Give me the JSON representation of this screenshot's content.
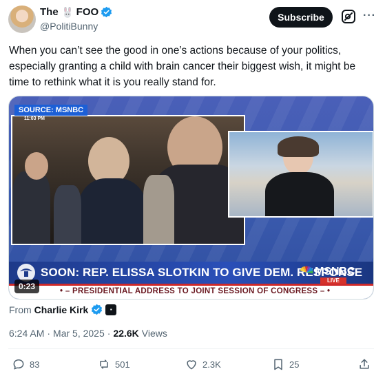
{
  "author": {
    "name_prefix": "The",
    "name_suffix": "FOO",
    "handle": "@PolitiBunny",
    "avatar_icon": "profile-photo"
  },
  "header_actions": {
    "subscribe_label": "Subscribe",
    "grok_icon": "grok-icon",
    "more_label": "···"
  },
  "tweet": {
    "text": "When you can’t see the good in one’s actions because of your politics, especially granting a child with brain cancer their biggest wish, it might be time to rethink what it is you really stand for."
  },
  "video": {
    "source_tag": "SOURCE: MSNBC",
    "timestamp": "11:03 PM",
    "headline": "SOON: REP. ELISSA SLOTKIN TO GIVE DEM. RESPONSE",
    "network": "MSNBC",
    "live": "LIVE",
    "subline": "• – PRESIDENTIAL ADDRESS TO JOINT SESSION OF CONGRESS – •",
    "duration": "0:23"
  },
  "attribution": {
    "from_label": "From",
    "from_name": "Charlie Kirk"
  },
  "meta": {
    "time": "6:24 AM",
    "date": "Mar 5, 2025",
    "views_count": "22.6K",
    "views_label": "Views",
    "separator": "·"
  },
  "actions": {
    "replies": "83",
    "reposts": "501",
    "likes": "2.3K",
    "bookmarks": "25"
  },
  "colors": {
    "accent": "#1d9bf0",
    "text": "#0f1419",
    "muted": "#536471"
  }
}
